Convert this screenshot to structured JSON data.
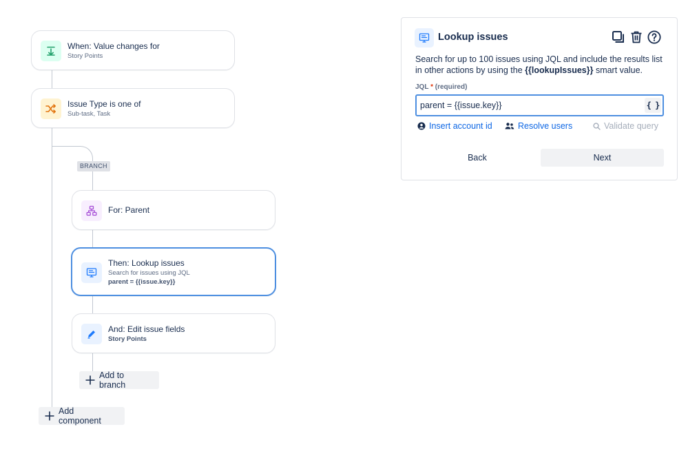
{
  "flow": {
    "trigger": {
      "title": "When: Value changes for",
      "subtitle": "Story Points",
      "icon": "field-change-icon",
      "icon_color": "#22a06b"
    },
    "condition": {
      "title": "Issue Type is one of",
      "subtitle": "Sub-task, Task",
      "icon": "condition-shuffle-icon",
      "icon_color": "#e2740f"
    },
    "branch_label": "BRANCH",
    "branch": {
      "for": {
        "title": "For: Parent",
        "icon": "hierarchy-icon",
        "icon_color": "#a54cd6"
      },
      "lookup": {
        "title": "Then: Lookup issues",
        "subtitle": "Search for issues using JQL",
        "detail": "parent = {{issue.key}}",
        "icon": "monitor-icon",
        "icon_color": "#1d7afc"
      },
      "edit": {
        "title": "And: Edit issue fields",
        "subtitle": "Story Points",
        "icon": "pencil-icon",
        "icon_color": "#1d7afc"
      }
    },
    "add_to_branch": "Add to branch",
    "add_component": "Add component"
  },
  "panel": {
    "title": "Lookup issues",
    "icon": "monitor-icon",
    "tools": [
      "duplicate-icon",
      "trash-icon",
      "help-icon"
    ],
    "desc_before": "Search for up to 100 issues using JQL and include the results list in other actions by using the ",
    "desc_smart": "{{lookupIssues}}",
    "desc_after": " smart value.",
    "jql_label": "JQL",
    "jql_required_mark": "*",
    "jql_required_text": "(required)",
    "jql_value": "parent = {{issue.key}}",
    "braces": "{ }",
    "insert_account": "Insert account id",
    "resolve_users": "Resolve users",
    "validate_query": "Validate query",
    "back": "Back",
    "next": "Next"
  },
  "colors": {
    "accent": "#0c66e4",
    "selected_border": "#4c8ee0",
    "required": "#de350b"
  }
}
